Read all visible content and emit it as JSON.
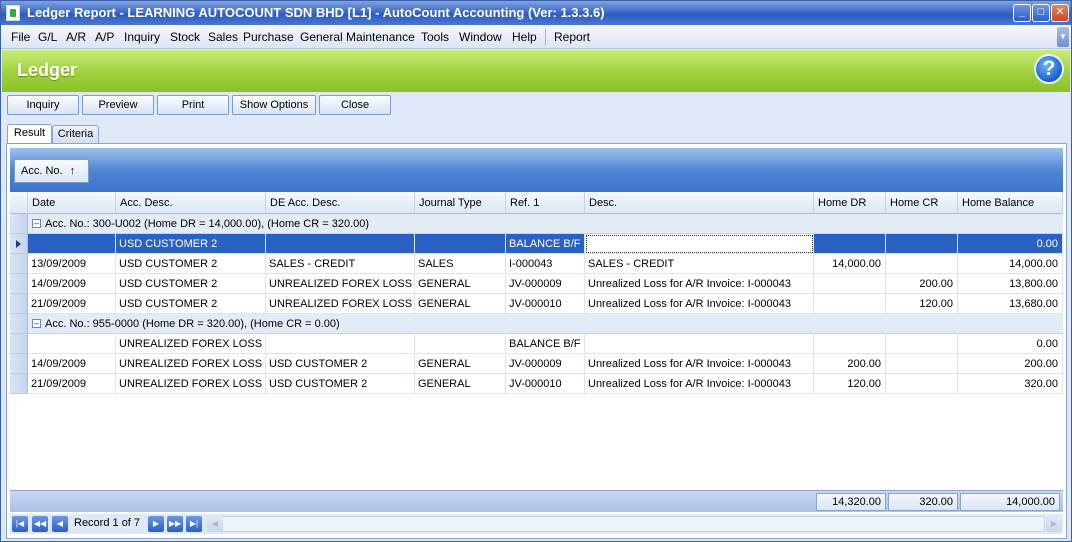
{
  "window": {
    "title": "Ledger Report - LEARNING AUTOCOUNT SDN BHD [L1] - AutoCount Accounting (Ver: 1.3.3.6)"
  },
  "menu": [
    "File",
    "G/L",
    "A/R",
    "A/P",
    "Inquiry",
    "Stock",
    "Sales",
    "Purchase",
    "General Maintenance",
    "Tools",
    "Window",
    "Help",
    "Report"
  ],
  "header": {
    "title": "Ledger"
  },
  "toolbar": {
    "inquiry": "Inquiry",
    "preview": "Preview",
    "print": "Print",
    "show_options": "Show Options",
    "close": "Close"
  },
  "tabs": {
    "result": "Result",
    "criteria": "Criteria"
  },
  "group_by": {
    "label": "Acc. No.",
    "sort_icon": "↑"
  },
  "columns": [
    "Date",
    "Acc. Desc.",
    "DE Acc. Desc.",
    "Journal Type",
    "Ref. 1",
    "Desc.",
    "Home DR",
    "Home CR",
    "Home Balance"
  ],
  "groups": [
    {
      "label": "Acc. No.: 300-U002 (Home DR = 14,000.00), (Home CR = 320.00)",
      "rows": [
        [
          "",
          "USD CUSTOMER 2",
          "",
          "",
          "BALANCE B/F",
          "",
          "",
          "",
          "0.00"
        ],
        [
          "13/09/2009",
          "USD CUSTOMER 2",
          "SALES - CREDIT",
          "SALES",
          "I-000043",
          "SALES - CREDIT",
          "14,000.00",
          "",
          "14,000.00"
        ],
        [
          "14/09/2009",
          "USD CUSTOMER 2",
          "UNREALIZED  FOREX LOSS",
          "GENERAL",
          "JV-000009",
          "Unrealized Loss for A/R Invoice: I-000043",
          "",
          "200.00",
          "13,800.00"
        ],
        [
          "21/09/2009",
          "USD CUSTOMER 2",
          "UNREALIZED  FOREX LOSS",
          "GENERAL",
          "JV-000010",
          "Unrealized Loss for A/R Invoice: I-000043",
          "",
          "120.00",
          "13,680.00"
        ]
      ]
    },
    {
      "label": "Acc. No.: 955-0000 (Home DR = 320.00), (Home CR = 0.00)",
      "rows": [
        [
          "",
          "UNREALIZED  FOREX LOSS",
          "",
          "",
          "BALANCE B/F",
          "",
          "",
          "",
          "0.00"
        ],
        [
          "14/09/2009",
          "UNREALIZED  FOREX LOSS",
          "USD CUSTOMER 2",
          "GENERAL",
          "JV-000009",
          "Unrealized Loss for A/R Invoice: I-000043",
          "200.00",
          "",
          "200.00"
        ],
        [
          "21/09/2009",
          "UNREALIZED  FOREX LOSS",
          "USD CUSTOMER 2",
          "GENERAL",
          "JV-000010",
          "Unrealized Loss for A/R Invoice: I-000043",
          "120.00",
          "",
          "320.00"
        ]
      ]
    }
  ],
  "totals": {
    "home_dr": "14,320.00",
    "home_cr": "320.00",
    "home_balance": "14,000.00"
  },
  "navigator": {
    "record_text": "Record 1 of 7"
  }
}
